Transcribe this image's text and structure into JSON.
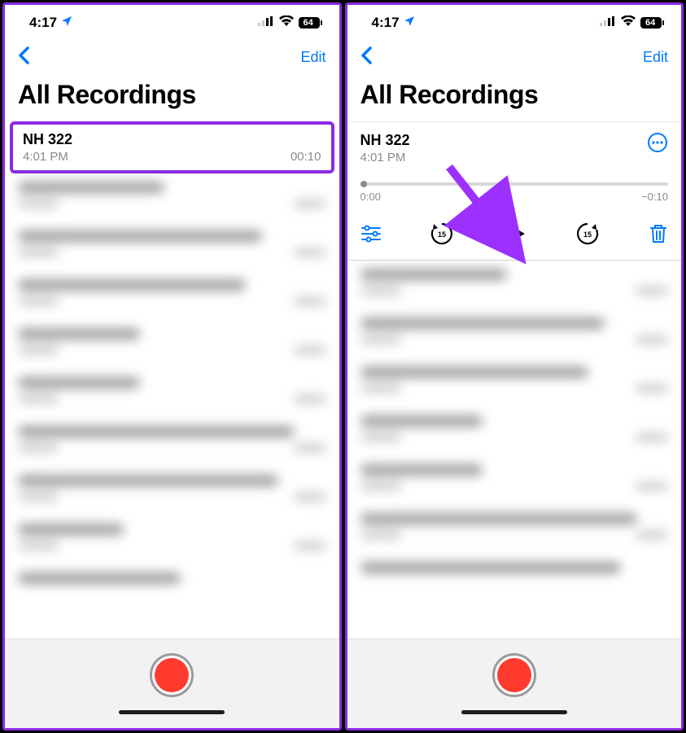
{
  "colors": {
    "accent": "#007aff",
    "record": "#ff3b30",
    "highlight": "#8a2be2"
  },
  "status": {
    "time": "4:17",
    "battery": "64"
  },
  "nav": {
    "edit_label": "Edit"
  },
  "page_title": "All Recordings",
  "left": {
    "recording": {
      "title": "NH 322",
      "time": "4:01 PM",
      "duration": "00:10"
    }
  },
  "right": {
    "recording": {
      "title": "NH 322",
      "time": "4:01 PM"
    },
    "scrubber": {
      "elapsed": "0:00",
      "remaining": "−0:10"
    }
  }
}
